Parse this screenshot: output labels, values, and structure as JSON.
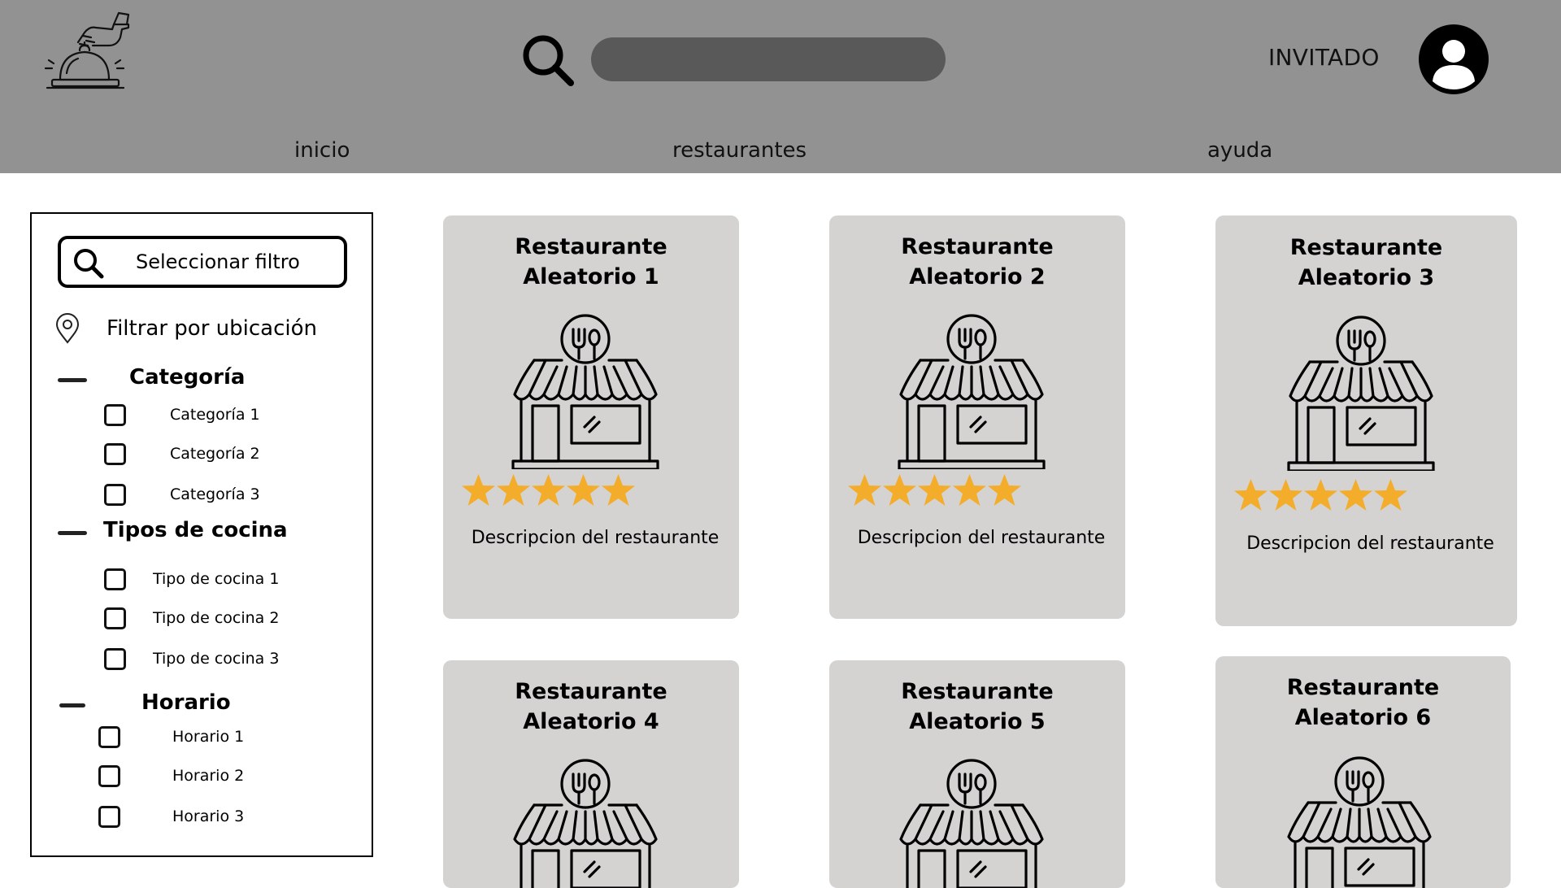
{
  "header": {
    "search": {
      "value": "",
      "placeholder": ""
    },
    "user_label": "INVITADO",
    "nav": [
      {
        "label": "inicio"
      },
      {
        "label": "restaurantes"
      },
      {
        "label": "ayuda"
      }
    ]
  },
  "sidebar": {
    "filter_label": "Seleccionar filtro",
    "location_label": "Filtrar por ubicación",
    "sections": [
      {
        "title": "Categoría",
        "options": [
          "Categoría 1",
          "Categoría 2",
          "Categoría 3"
        ]
      },
      {
        "title": "Tipos de cocina",
        "options": [
          "Tipo de cocina 1",
          "Tipo de cocina 2",
          "Tipo de cocina 3"
        ]
      },
      {
        "title": "Horario",
        "options": [
          "Horario 1",
          "Horario 2",
          "Horario 3"
        ]
      }
    ]
  },
  "restaurants": [
    {
      "title_line1": "Restaurante",
      "title_line2": "Aleatorio 1",
      "rating": 5,
      "description": "Descripcion del restaurante"
    },
    {
      "title_line1": "Restaurante",
      "title_line2": "Aleatorio 2",
      "rating": 5,
      "description": "Descripcion del restaurante"
    },
    {
      "title_line1": "Restaurante",
      "title_line2": "Aleatorio 3",
      "rating": 5,
      "description": "Descripcion del restaurante"
    },
    {
      "title_line1": "Restaurante",
      "title_line2": "Aleatorio 4"
    },
    {
      "title_line1": "Restaurante",
      "title_line2": "Aleatorio 5"
    },
    {
      "title_line1": "Restaurante",
      "title_line2": "Aleatorio 6"
    }
  ],
  "colors": {
    "header_bg": "#929292",
    "search_bar": "#595959",
    "card_bg": "#d4d3d2",
    "star": "#f3ad2b"
  }
}
